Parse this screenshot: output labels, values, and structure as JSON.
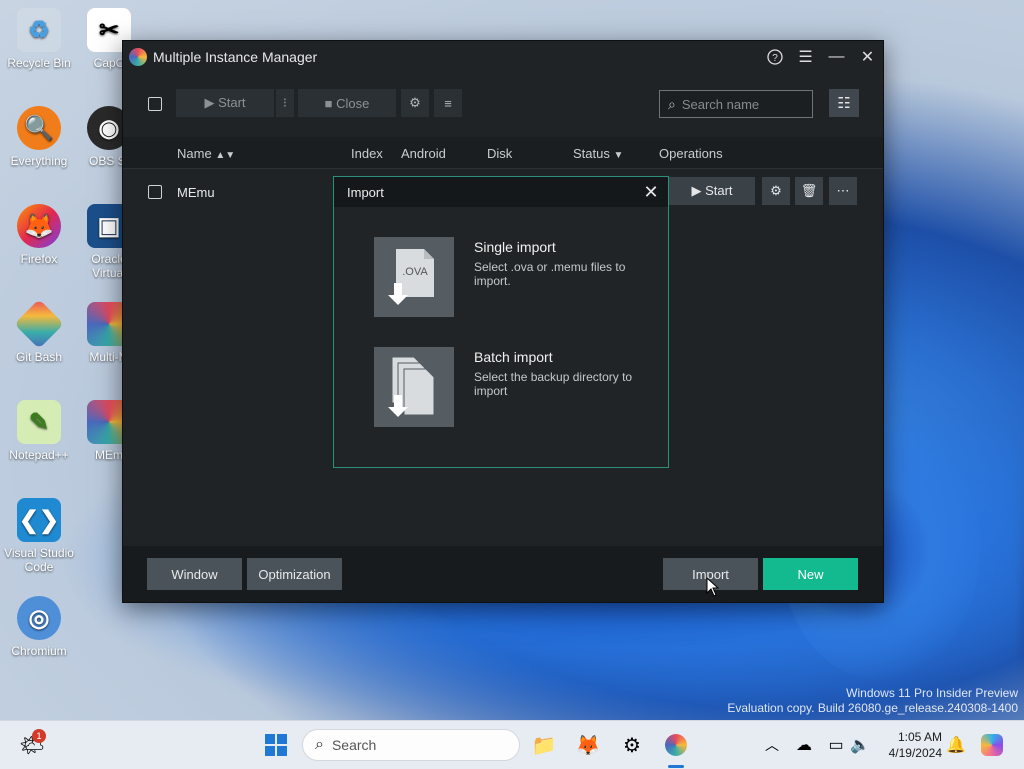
{
  "desktop": {
    "icons": [
      {
        "label": "Recycle Bin"
      },
      {
        "label": "CapC"
      },
      {
        "label": "Everything"
      },
      {
        "label": "OBS St"
      },
      {
        "label": "Firefox"
      },
      {
        "label": "Oracle Virtual"
      },
      {
        "label": "Git Bash"
      },
      {
        "label": "Multi-M"
      },
      {
        "label": "Notepad++"
      },
      {
        "label": "MEm"
      },
      {
        "label": "Visual Studio Code"
      },
      {
        "label": "Chromium"
      }
    ],
    "watermark_line1": "Windows 11 Pro Insider Preview",
    "watermark_line2": "Evaluation copy. Build 26080.ge_release.240308-1400"
  },
  "window": {
    "title": "Multiple Instance Manager",
    "toolbar": {
      "start_label": "▶ Start",
      "more_label": "⁝",
      "close_label": "■ Close",
      "search_placeholder": "Search name"
    },
    "columns": {
      "name": "Name",
      "index": "Index",
      "android": "Android",
      "disk": "Disk",
      "status": "Status",
      "operations": "Operations"
    },
    "rows": [
      {
        "name": "MEmu",
        "start_label": "▶ Start"
      }
    ],
    "bottom": {
      "window_label": "Window",
      "optimization_label": "Optimization",
      "import_label": "Import",
      "new_label": "New"
    },
    "accent": "#13b98f"
  },
  "dialog": {
    "title": "Import",
    "single": {
      "title": "Single import",
      "desc": "Select .ova or .memu files to import.",
      "badge": ".OVA"
    },
    "batch": {
      "title": "Batch import",
      "desc": "Select the backup directory to import"
    }
  },
  "taskbar": {
    "search_placeholder": "Search",
    "time": "1:05 AM",
    "date": "4/19/2024",
    "weather_badge": "1"
  }
}
